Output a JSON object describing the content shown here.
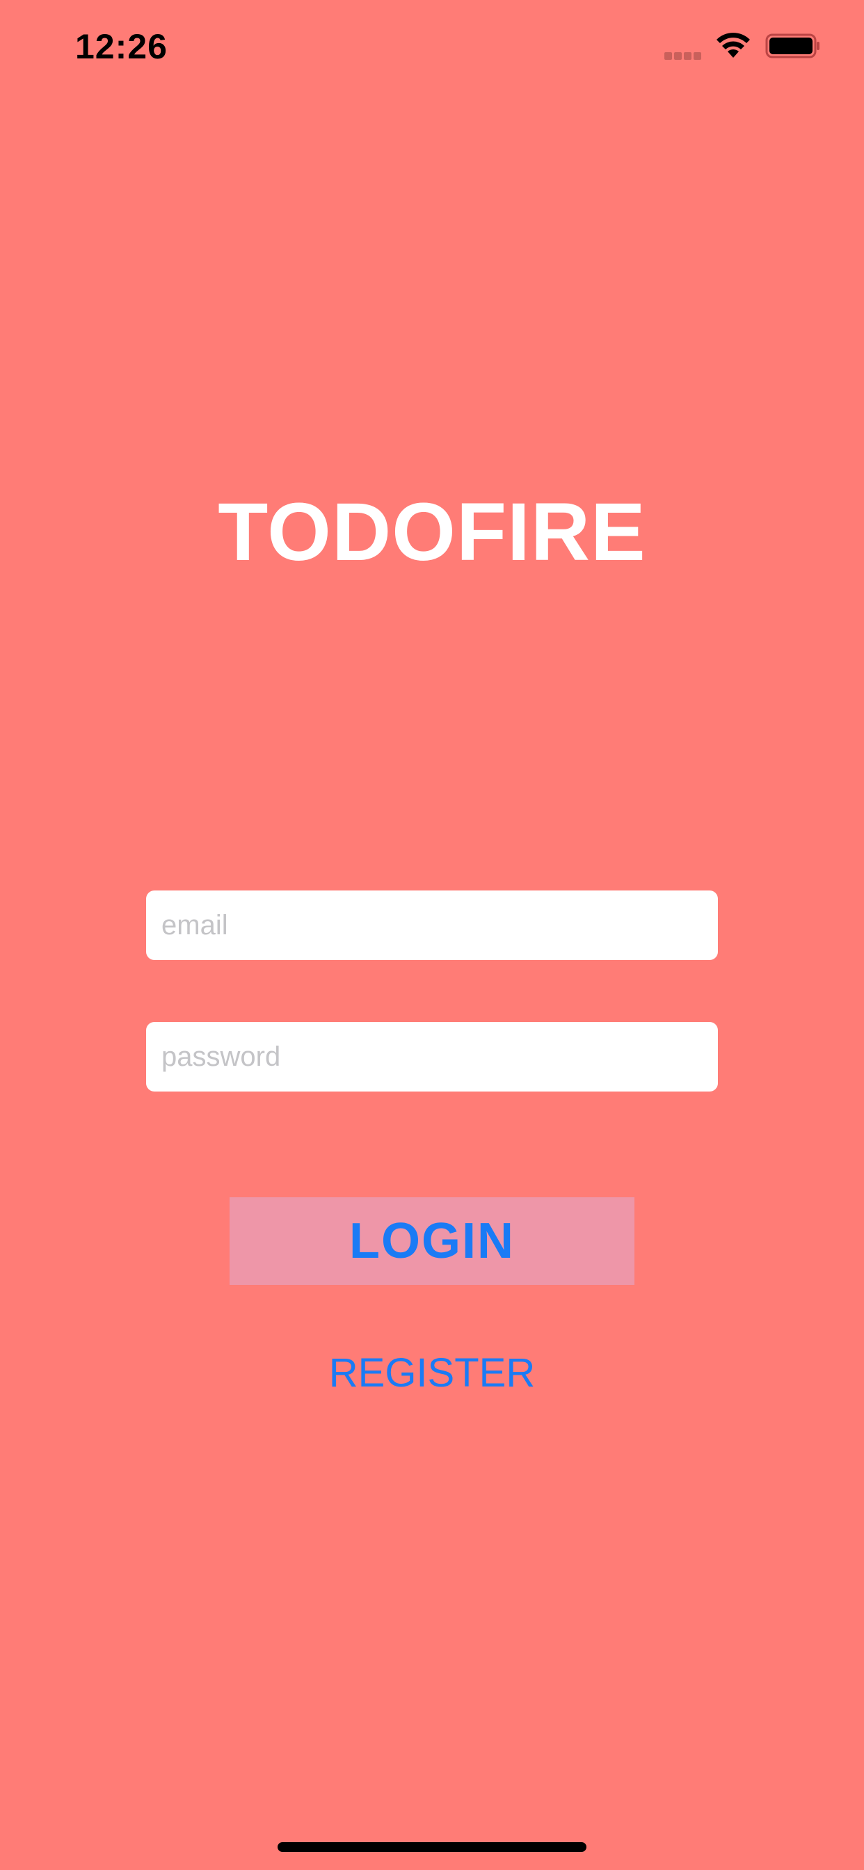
{
  "status_bar": {
    "time": "12:26",
    "icons": [
      "signal-icon",
      "wifi-icon",
      "battery-icon"
    ]
  },
  "app": {
    "title": "TODOFIRE"
  },
  "login_form": {
    "email_placeholder": "email",
    "email_value": "",
    "password_placeholder": "password",
    "password_value": "",
    "login_label": "LOGIN",
    "register_label": "REGISTER"
  },
  "colors": {
    "background": "#FF7C76",
    "button_background": "#EE96A8",
    "accent": "#1A7BF5",
    "title": "#FFFFFF"
  }
}
